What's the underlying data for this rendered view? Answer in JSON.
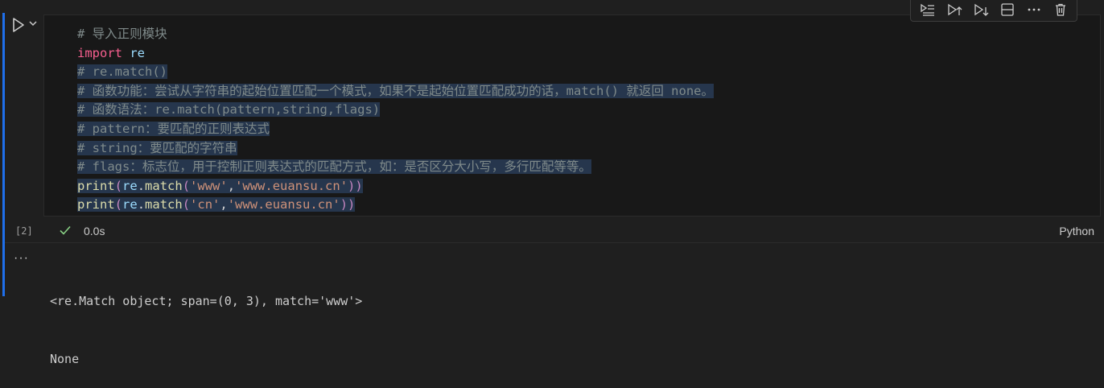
{
  "code_lines": [
    [
      {
        "t": "# 导入正则模块",
        "c": "cm plain"
      }
    ],
    [
      {
        "t": "import",
        "c": "kw"
      },
      {
        "t": " re",
        "c": "mod"
      }
    ],
    [
      {
        "t": "# re.match()",
        "c": "cm plain"
      }
    ],
    [
      {
        "t": "# 函数功能：尝试从字符串的起始位置匹配一个模式，如果不是起始位置匹配成功的话，match() 就返回 none。",
        "c": "cm plain"
      }
    ],
    [
      {
        "t": "# 函数语法：re.match(pattern,string,flags)",
        "c": "cm plain"
      }
    ],
    [
      {
        "t": "# pattern：要匹配的正则表达式",
        "c": "cm plain"
      }
    ],
    [
      {
        "t": "# string：要匹配的字符串",
        "c": "cm plain"
      }
    ],
    [
      {
        "t": "# flags：标志位，用于控制正则表达式的匹配方式，如：是否区分大小写，多行匹配等等。",
        "c": "cm plain"
      }
    ],
    [
      {
        "t": "print",
        "c": "fn"
      },
      {
        "t": "(",
        "c": "pl"
      },
      {
        "t": "re",
        "c": "var"
      },
      {
        "t": ".",
        "c": "pu"
      },
      {
        "t": "match",
        "c": "fn"
      },
      {
        "t": "(",
        "c": "pl"
      },
      {
        "t": "'www'",
        "c": "st"
      },
      {
        "t": ",",
        "c": "pu"
      },
      {
        "t": "'www.euansu.cn'",
        "c": "st"
      },
      {
        "t": "))",
        "c": "pl"
      }
    ],
    [
      {
        "t": "print",
        "c": "fn"
      },
      {
        "t": "(",
        "c": "pl"
      },
      {
        "t": "re",
        "c": "var"
      },
      {
        "t": ".",
        "c": "pu"
      },
      {
        "t": "match",
        "c": "fn"
      },
      {
        "t": "(",
        "c": "pl"
      },
      {
        "t": "'cn'",
        "c": "st"
      },
      {
        "t": ",",
        "c": "pu"
      },
      {
        "t": "'www.euansu.cn'",
        "c": "st"
      },
      {
        "t": "))",
        "c": "pl"
      }
    ]
  ],
  "selected_lines": [
    2,
    3,
    4,
    5,
    6,
    7,
    8,
    9
  ],
  "cell": {
    "execution_count": "[2]",
    "duration": "0.0s",
    "language": "Python"
  },
  "output": {
    "lines": [
      "<re.Match object; span=(0, 3), match='www'>",
      "None"
    ],
    "menu_label": "···"
  },
  "toolbar": {
    "icons": [
      "run-by-line-icon",
      "execute-above-icon",
      "execute-below-icon",
      "split-cell-icon",
      "more-actions-icon",
      "delete-cell-icon"
    ]
  },
  "colors": {
    "accent": "#1f6feb",
    "success": "#89d185",
    "comment": "#7f8a8a",
    "keyword": "#f75f8f",
    "string": "#ce9178",
    "function": "#dcdcaa"
  }
}
